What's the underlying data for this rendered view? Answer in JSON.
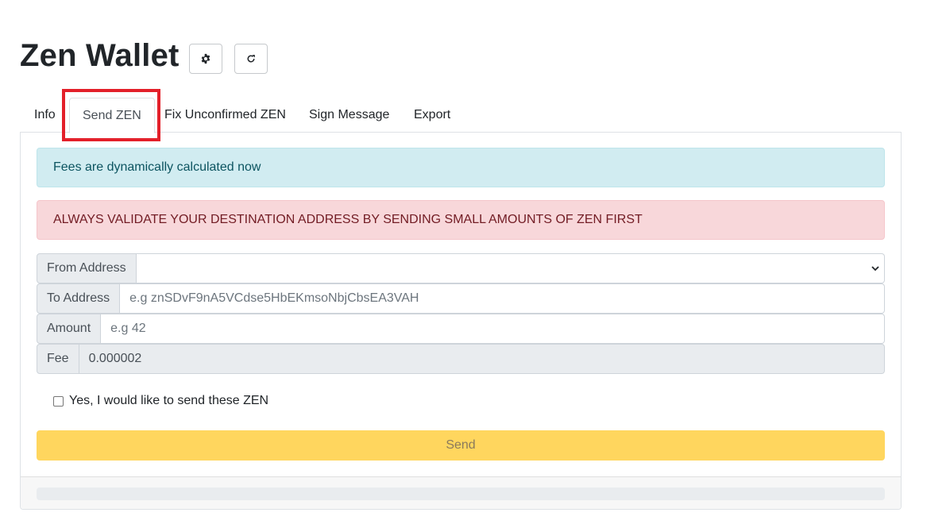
{
  "header": {
    "title": "Zen Wallet",
    "settings_icon": "gear-icon",
    "refresh_icon": "refresh-icon"
  },
  "tabs": [
    {
      "label": "Info",
      "active": false
    },
    {
      "label": "Send ZEN",
      "active": true
    },
    {
      "label": "Fix Unconfirmed ZEN",
      "active": false
    },
    {
      "label": "Sign Message",
      "active": false
    },
    {
      "label": "Export",
      "active": false
    }
  ],
  "alerts": {
    "info": "Fees are dynamically calculated now",
    "danger": "ALWAYS VALIDATE YOUR DESTINATION ADDRESS BY SENDING SMALL AMOUNTS OF ZEN FIRST"
  },
  "form": {
    "from_label": "From Address",
    "from_value": "",
    "to_label": "To Address",
    "to_placeholder": "e.g znSDvF9nA5VCdse5HbEKmsoNbjCbsEA3VAH",
    "amount_label": "Amount",
    "amount_placeholder": "e.g 42",
    "fee_label": "Fee",
    "fee_value": "0.000002",
    "confirm_label": "Yes, I would like to send these ZEN",
    "confirm_checked": false,
    "send_label": "Send"
  },
  "progress": {
    "value": 0
  },
  "colors": {
    "highlight": "#e3202a",
    "info_bg": "#d1ecf1",
    "danger_bg": "#f8d7da",
    "send_bg": "#ffd65e"
  }
}
